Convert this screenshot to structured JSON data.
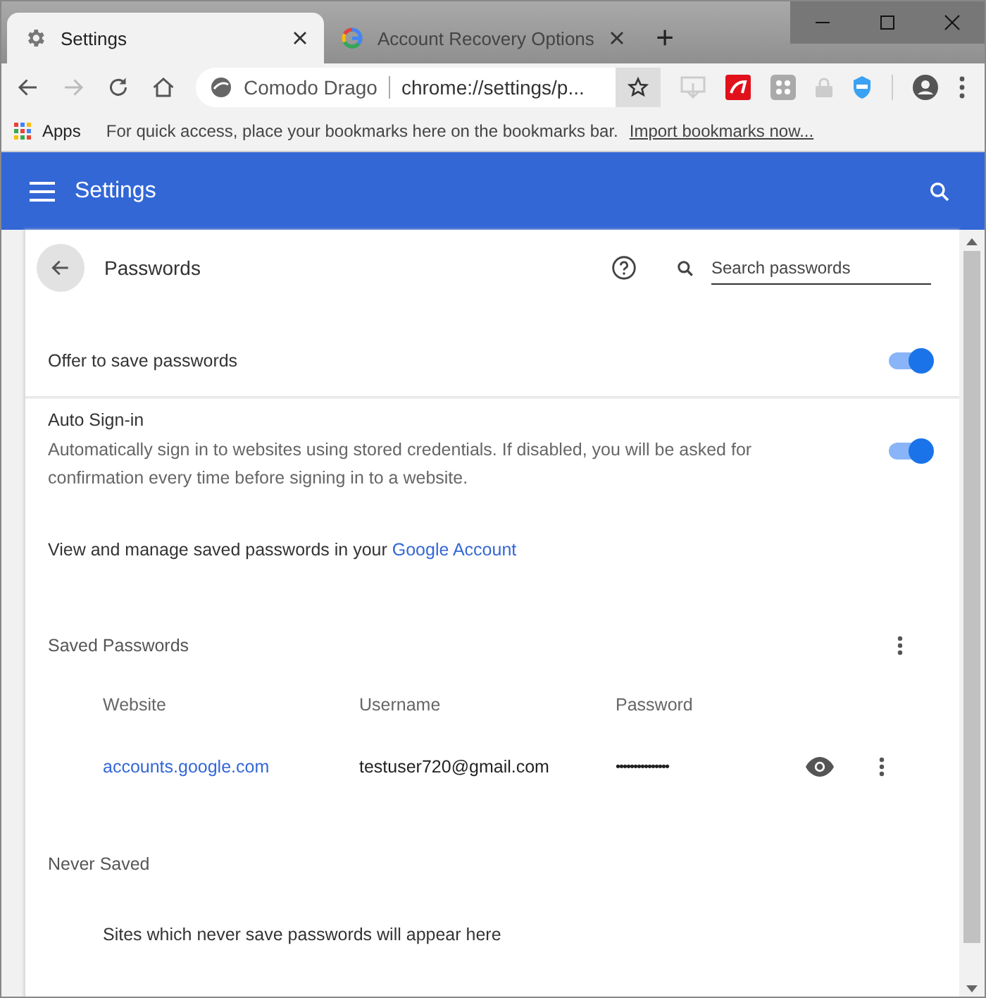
{
  "browser": {
    "tabs": [
      {
        "title": "Settings",
        "selected": true,
        "kind": "gear"
      },
      {
        "title": "Account Recovery Options",
        "selected": false,
        "kind": "google"
      }
    ],
    "new_tab": "+",
    "address": {
      "site": "Comodo Drago",
      "url": "chrome://settings/p..."
    },
    "bookmarks_bar": {
      "apps": "Apps",
      "hint": "For quick access, place your bookmarks here on the bookmarks bar.",
      "link": "Import bookmarks now..."
    }
  },
  "header": {
    "title": "Settings"
  },
  "page": {
    "title": "Passwords",
    "search": {
      "placeholder": "Search passwords"
    },
    "settings": [
      {
        "label": "Offer to save passwords",
        "on": true
      },
      {
        "label": "Auto Sign-in",
        "description": "Automatically sign in to websites using stored credentials. If disabled, you will be asked for confirmation every time before signing in to a website.",
        "on": true
      }
    ],
    "manage": {
      "text": "View and manage saved passwords in your ",
      "link": "Google Account"
    },
    "saved": {
      "title": "Saved Passwords",
      "columns": [
        "Website",
        "Username",
        "Password"
      ],
      "rows": [
        {
          "website": "accounts.google.com",
          "username": "testuser720@gmail.com",
          "password": "•••••••••••••••"
        }
      ]
    },
    "never_saved": {
      "title": "Never Saved",
      "empty": "Sites which never save passwords will appear here"
    }
  }
}
